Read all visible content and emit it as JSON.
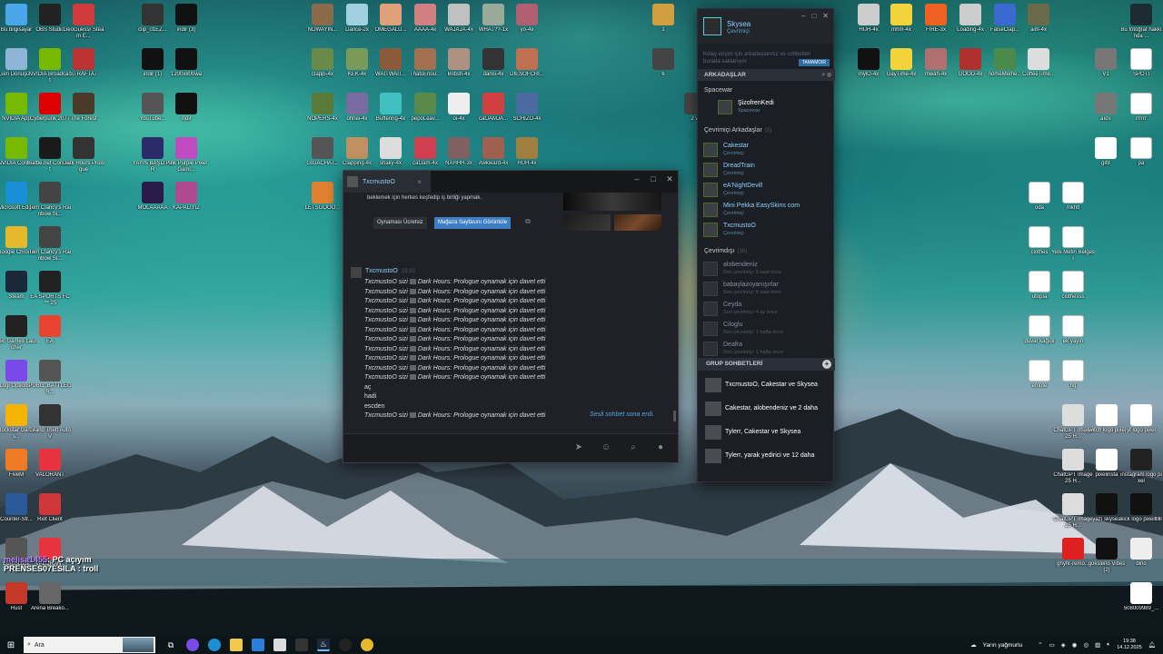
{
  "desktop": {
    "left_icons": [
      {
        "label": "Bu bilgisayar",
        "icon": "computer-icon",
        "color": "#4aa6e8"
      },
      {
        "label": "OBS Studio",
        "icon": "obs-icon",
        "color": "#222222"
      },
      {
        "label": "GeoGuessr Steam E...",
        "icon": "map-pin-icon",
        "color": "#d13b3b"
      },
      {
        "label": "Geri Dönüşü...",
        "icon": "recycle-bin-icon",
        "color": "#8fb5d6"
      },
      {
        "label": "NVIDIA Broadcast",
        "icon": "nvidia-icon",
        "color": "#76b900"
      },
      {
        "label": "STRAFTAT",
        "icon": "game-icon",
        "color": "#b33"
      },
      {
        "label": "NVIDIA App",
        "icon": "nvidia-icon",
        "color": "#76b900"
      },
      {
        "label": "Cyberpunk 2077",
        "icon": "game-icon",
        "color": "#d00"
      },
      {
        "label": "The Forest",
        "icon": "game-icon",
        "color": "#4a3a2a"
      },
      {
        "label": "NVIDIA Contr...",
        "icon": "nvidia-icon",
        "color": "#76b900"
      },
      {
        "label": "Battle.net Connect",
        "icon": "game-icon",
        "color": "#1a1a1a"
      },
      {
        "label": "Dark Hours Prologue",
        "icon": "game-icon",
        "color": "#333"
      },
      {
        "label": "Microsoft Edge",
        "icon": "edge-icon",
        "color": "#1b8fd6"
      },
      {
        "label": "Tom Clancy's Rainbow Si...",
        "icon": "game-icon",
        "color": "#444"
      },
      {
        "label": "Google Chrome",
        "icon": "chrome-icon",
        "color": "#e5b92b"
      },
      {
        "label": "Tom Clancy's Rainbow Si...",
        "icon": "game-icon",
        "color": "#444"
      },
      {
        "label": "Steam",
        "icon": "steam-icon",
        "color": "#1b2838"
      },
      {
        "label": "EA SPORTS FC™ 25",
        "icon": "game-icon",
        "color": "#222"
      },
      {
        "label": "Epic Games Launcher",
        "icon": "epic-icon",
        "color": "#222"
      },
      {
        "label": "EA",
        "icon": "ea-icon",
        "color": "#e8442f"
      },
      {
        "label": "Logi Options+",
        "icon": "logi-icon",
        "color": "#7a4ae8"
      },
      {
        "label": "PUBG: BATTLEGR...",
        "icon": "game-icon",
        "color": "#555"
      },
      {
        "label": "Rockstar Games...",
        "icon": "rockstar-icon",
        "color": "#f4b400"
      },
      {
        "label": "Grand Theft Auto V",
        "icon": "game-icon",
        "color": "#333"
      },
      {
        "label": "FiveM",
        "icon": "fivem-icon",
        "color": "#f07b26"
      },
      {
        "label": "VALORANT",
        "icon": "valorant-icon",
        "color": "#e8323e"
      },
      {
        "label": "Counter-Str...",
        "icon": "cs-icon",
        "color": "#2a5a9a"
      },
      {
        "label": "Riot Client",
        "icon": "riot-icon",
        "color": "#d13639"
      },
      {
        "label": "EuroScope",
        "icon": "game-icon",
        "color": "#555"
      },
      {
        "label": "VALORANT",
        "icon": "valorant-icon",
        "color": "#e8323e"
      },
      {
        "label": "Rust",
        "icon": "game-icon",
        "color": "#c43a2a"
      },
      {
        "label": "Arena Breako...",
        "icon": "game-icon",
        "color": "#666"
      }
    ],
    "mid_icons": [
      {
        "label": "clip_01EZ...",
        "icon": "video-icon",
        "color": "#333"
      },
      {
        "label": "indir (3)",
        "icon": "image-icon",
        "color": "#111"
      },
      {
        "label": "indir (1)",
        "icon": "kick-icon",
        "color": "#111"
      },
      {
        "label": "1200x800wa",
        "icon": "kick-icon",
        "color": "#111"
      },
      {
        "label": "YouTube...",
        "icon": "image-icon",
        "color": "#555"
      },
      {
        "label": "indir",
        "icon": "kick-icon",
        "color": "#111"
      },
      {
        "label": "YAYIN BAŞLIYOR",
        "icon": "image-icon",
        "color": "#2b2b6a"
      },
      {
        "label": "Pink Purple Pixel Gami...",
        "icon": "image-icon",
        "color": "#c04ac0"
      },
      {
        "label": "MOLAAAAA",
        "icon": "image-icon",
        "color": "#2b1b4a"
      },
      {
        "label": "KAPALIYIZ",
        "icon": "image-icon",
        "color": "#b04a90"
      }
    ],
    "emote_icons": [
      {
        "label": "NOWAYIN...",
        "icon": "emote-icon",
        "color": "#8a6a4a"
      },
      {
        "label": "Dance-2x",
        "icon": "emote-icon",
        "color": "#a0d0e0"
      },
      {
        "label": "OMEGALU...",
        "icon": "emote-icon",
        "color": "#e0a07a"
      },
      {
        "label": "AAAA-4x",
        "icon": "emote-icon",
        "color": "#d08080"
      },
      {
        "label": "WAJAJA-4x",
        "icon": "emote-icon",
        "color": "#c0c0c0"
      },
      {
        "label": "WHAT??-1x",
        "icon": "emote-icon",
        "color": "#9a9"
      },
      {
        "label": "yo-4x",
        "icon": "emote-icon",
        "color": "#b06070"
      },
      {
        "label": "clappi-4x",
        "icon": "emote-icon",
        "color": "#6a8a4a"
      },
      {
        "label": "KEK-4x",
        "icon": "emote-icon",
        "color": "#7a9a5a"
      },
      {
        "label": "WAITWAIT...",
        "icon": "emote-icon",
        "color": "#8a5a3a"
      },
      {
        "label": "ThatsEnou...",
        "icon": "emote-icon",
        "color": "#a07050"
      },
      {
        "label": "British-4x",
        "icon": "emote-icon",
        "color": "#b09080"
      },
      {
        "label": "dansi-4x",
        "icon": "emote-icon",
        "color": "#333"
      },
      {
        "label": "DİESOFCRI...",
        "icon": "emote-icon",
        "color": "#c07050"
      },
      {
        "label": "NOPERS-4x",
        "icon": "emote-icon",
        "color": "#5a7a3a"
      },
      {
        "label": "ohnei-4x",
        "icon": "emote-icon",
        "color": "#7a6aa0"
      },
      {
        "label": "Buffering-4x",
        "icon": "emote-icon",
        "color": "#40c0c0"
      },
      {
        "label": "pepoLeav...",
        "icon": "emote-icon",
        "color": "#5a8a4a"
      },
      {
        "label": "oi-4x",
        "icon": "emote-icon",
        "color": "#eeeeee"
      },
      {
        "label": "catJAMJA...",
        "icon": "emote-icon",
        "color": "#d04040"
      },
      {
        "label": "SCHIZO-4x",
        "icon": "emote-icon",
        "color": "#4a6aa0"
      },
      {
        "label": "GIGACHAT...",
        "icon": "emote-icon",
        "color": "#555"
      },
      {
        "label": "Clapping-4x",
        "icon": "emote-icon",
        "color": "#c09060"
      },
      {
        "label": "shaky-4x",
        "icon": "emote-icon",
        "color": "#ddd"
      },
      {
        "label": "catJam-4x",
        "icon": "emote-icon",
        "color": "#d04050"
      },
      {
        "label": "NAHHH-3x",
        "icon": "emote-icon",
        "color": "#806060"
      },
      {
        "label": "Awkward-4x",
        "icon": "emote-icon",
        "color": "#a06050"
      },
      {
        "label": "HUH-4x",
        "icon": "emote-icon",
        "color": "#a08040"
      },
      {
        "label": "LETSGOOO...",
        "icon": "emote-icon",
        "color": "#e08030"
      }
    ],
    "right_icons": [
      {
        "label": "HUH-4x",
        "icon": "emote-icon",
        "color": "#ccc"
      },
      {
        "label": "mhm-4x",
        "icon": "emote-icon",
        "color": "#f2d33a"
      },
      {
        "label": "FIRE-3x",
        "icon": "emote-icon",
        "color": "#f06020"
      },
      {
        "label": "Loading-4x",
        "icon": "emote-icon",
        "color": "#ccc"
      },
      {
        "label": "FalseClap...",
        "icon": "emote-icon",
        "color": "#3a6ad0"
      },
      {
        "label": "aim-4x",
        "icon": "emote-icon",
        "color": "#6a6a4a"
      },
      {
        "label": "myiO-4x",
        "icon": "emote-icon",
        "color": "#111"
      },
      {
        "label": "GayTime-4x",
        "icon": "emote-icon",
        "color": "#f2d33a"
      },
      {
        "label": "mwah-4x",
        "icon": "emote-icon",
        "color": "#b07070"
      },
      {
        "label": "GOOD-4x",
        "icon": "emote-icon",
        "color": "#b03030"
      },
      {
        "label": "nomeMeme...",
        "icon": "emote-icon",
        "color": "#4a8a4a"
      },
      {
        "label": "CoffeeTime...",
        "icon": "emote-icon",
        "color": "#ddd"
      },
      {
        "label": "Bu fotoğraf hakkında ...",
        "icon": "info-icon",
        "color": "#1d2c33"
      },
      {
        "label": "V1",
        "icon": "image-icon",
        "color": "#777"
      },
      {
        "label": "SPOTİ",
        "icon": "doc-icon",
        "color": "#fff"
      },
      {
        "label": "aıdıı",
        "icon": "image-icon",
        "color": "#777"
      },
      {
        "label": "rrrrrr",
        "icon": "doc-icon",
        "color": "#fff"
      },
      {
        "label": "gif8",
        "icon": "image-icon",
        "color": "#ffffff"
      },
      {
        "label": "pa",
        "icon": "doc-icon",
        "color": "#fff"
      },
      {
        "label": "oda",
        "icon": "doc-icon",
        "color": "#fff"
      },
      {
        "label": "mkhtl",
        "icon": "doc-icon",
        "color": "#fff"
      },
      {
        "label": "clothes",
        "icon": "doc-icon",
        "color": "#fff"
      },
      {
        "label": "Yeni Metin Belgesi",
        "icon": "doc-icon",
        "color": "#fff"
      },
      {
        "label": "utopia",
        "icon": "doc-icon",
        "color": "#fff"
      },
      {
        "label": "clothesss",
        "icon": "doc-icon",
        "color": "#fff"
      },
      {
        "label": "duvar kağıdı",
        "icon": "doc-icon",
        "color": "#fff"
      },
      {
        "label": "ek yayın",
        "icon": "doc-icon",
        "color": "#fff"
      },
      {
        "label": "emote",
        "icon": "doc-icon",
        "color": "#fff"
      },
      {
        "label": "hg",
        "icon": "doc-icon",
        "color": "#fff"
      },
      {
        "label": "ChatGPT Image 25 H...",
        "icon": "image-icon",
        "color": "#ddd"
      },
      {
        "label": "twitch logo pixel",
        "icon": "image-icon",
        "color": "#fff"
      },
      {
        "label": "yt logo pixel",
        "icon": "image-icon",
        "color": "#fff"
      },
      {
        "label": "ChatGPT Image 25 H...",
        "icon": "image-icon",
        "color": "#ddd"
      },
      {
        "label": "pixelinsta",
        "icon": "image-icon",
        "color": "#fff"
      },
      {
        "label": "instagram logo pixel",
        "icon": "image-icon",
        "color": "#222"
      },
      {
        "label": "ChatGPT Image 25 H...",
        "icon": "image-icon",
        "color": "#ddd"
      },
      {
        "label": "yazı skysea",
        "icon": "image-icon",
        "color": "#111"
      },
      {
        "label": "kick logo pixelllllll",
        "icon": "kick-icon",
        "color": "#111"
      },
      {
        "label": "ghyhr-remo...",
        "icon": "youtube-icon",
        "color": "#e02020"
      },
      {
        "label": "goksleno Vibes (2)",
        "icon": "image-icon",
        "color": "#111"
      },
      {
        "label": "dino",
        "icon": "image-icon",
        "color": "#eee"
      },
      {
        "label": "508009989_...",
        "icon": "image-icon",
        "color": "#fff"
      }
    ],
    "small_extra": [
      {
        "label": "1",
        "icon": "emote-icon",
        "color": "#d0a040"
      },
      {
        "label": "6",
        "icon": "emote-icon",
        "color": "#444"
      },
      {
        "label": "2 w",
        "icon": "emote-icon",
        "color": "#444"
      }
    ]
  },
  "chat_window": {
    "tab_name": "TxcmustoO",
    "invite_desc": "beklemek için herkes keşfedip iş birliği yapmak.",
    "free_button": "Oynaması Ücretsiz",
    "store_button": "Mağaza Sayfasını Görüntüle",
    "sender": "TxcmustoO",
    "time": "19:33",
    "lines": [
      {
        "type": "invite",
        "text": "TxcmustoO sizi",
        "game": "Dark Hours: Prologue oynamak için davet etti"
      },
      {
        "type": "invite",
        "text": "TxcmustoO sizi",
        "game": "Dark Hours: Prologue oynamak için davet etti"
      },
      {
        "type": "invite",
        "text": "TxcmustoO sizi",
        "game": "Dark Hours: Prologue oynamak için davet etti"
      },
      {
        "type": "invite",
        "text": "TxcmustoO sizi",
        "game": "Dark Hours: Prologue oynamak için davet etti"
      },
      {
        "type": "invite",
        "text": "TxcmustoO sizi",
        "game": "Dark Hours: Prologue oynamak için davet etti"
      },
      {
        "type": "invite",
        "text": "TxcmustoO sizi",
        "game": "Dark Hours: Prologue oynamak için davet etti"
      },
      {
        "type": "invite",
        "text": "TxcmustoO sizi",
        "game": "Dark Hours: Prologue oynamak için davet etti"
      },
      {
        "type": "invite",
        "text": "TxcmustoO sizi",
        "game": "Dark Hours: Prologue oynamak için davet etti"
      },
      {
        "type": "invite",
        "text": "TxcmustoO sizi",
        "game": "Dark Hours: Prologue oynamak için davet etti"
      },
      {
        "type": "invite",
        "text": "TxcmustoO sizi",
        "game": "Dark Hours: Prologue oynamak için davet etti"
      },
      {
        "type": "invite",
        "text": "TxcmustoO sizi",
        "game": "Dark Hours: Prologue oynamak için davet etti"
      },
      {
        "type": "text",
        "text": "aç"
      },
      {
        "type": "text",
        "text": "hadi"
      },
      {
        "type": "text",
        "text": "escden"
      },
      {
        "type": "invite",
        "text": "TxcmustoO sizi",
        "game": "Dark Hours: Prologue oynamak için davet etti"
      },
      {
        "type": "invite",
        "text": "TxcmustoO sizi",
        "game": "Dark Hours: Prologue oynamak için davet etti"
      }
    ],
    "session_ended": "Sesli sohbet sona erdi."
  },
  "friends": {
    "user_name": "Skysea",
    "user_status": "Çevrimiçi",
    "notice": "Kolay erişim için arkadaşlarınız ve sohbetleri burada saklanıyor",
    "ok_button": "TAMAMDIR",
    "header": "ARKADAŞLAR",
    "spacewar_label": "Spacewar",
    "spacewar_friend": {
      "name": "ŞizofrenKedi",
      "status": "Spacewar"
    },
    "online_label": "Çevrimiçi Arkadaşlar",
    "online_count": "(5)",
    "online": [
      {
        "name": "Cakestar",
        "status": "Çevrimiçi"
      },
      {
        "name": "DreadTrain",
        "status": "Çevrimiçi"
      },
      {
        "name": "eA'NightDevil!",
        "status": "Çevrimiçi"
      },
      {
        "name": "Mini Pekka EasySkins com",
        "status": "Çevrimiçi"
      },
      {
        "name": "TxcmustoO",
        "status": "Çevrimiçi"
      }
    ],
    "offline_label": "Çevrimdışı",
    "offline_count": "(16)",
    "offline": [
      {
        "name": "alobendeniz",
        "status": "Son çevrimiçi: 5 saat önce"
      },
      {
        "name": "babaylazoyanışırlar",
        "status": "Son çevrimiçi: 8 saat önce"
      },
      {
        "name": "Ceyda",
        "status": "Son çevrimiçi: 4 ay önce"
      },
      {
        "name": "Ciloglu",
        "status": "Son çevrimiçi: 1 hafta önce"
      },
      {
        "name": "Deafra",
        "status": "Son çevrimiçi: 1 hafta önce"
      }
    ],
    "group_header": "GRUP SOHBETLERİ",
    "groups": [
      {
        "name": "TxcmustoO, Cakestar ve Skysea"
      },
      {
        "name": "Cakestar, alobendeniz ve 2 daha"
      },
      {
        "name": "Tylerr, Cakestar ve Skysea"
      },
      {
        "name": "Tylerr, yarak yedirici ve 12 daha"
      }
    ]
  },
  "overlay": {
    "user1": "melisa1455",
    "msg1": ": PC açıyım",
    "user2": "PRENSES07ESILA",
    "msg2": " : troll"
  },
  "taskbar": {
    "search_placeholder": "Ara",
    "weather": "Yarın yağmurlu",
    "time": "19:38",
    "date": "14.12.2025"
  }
}
